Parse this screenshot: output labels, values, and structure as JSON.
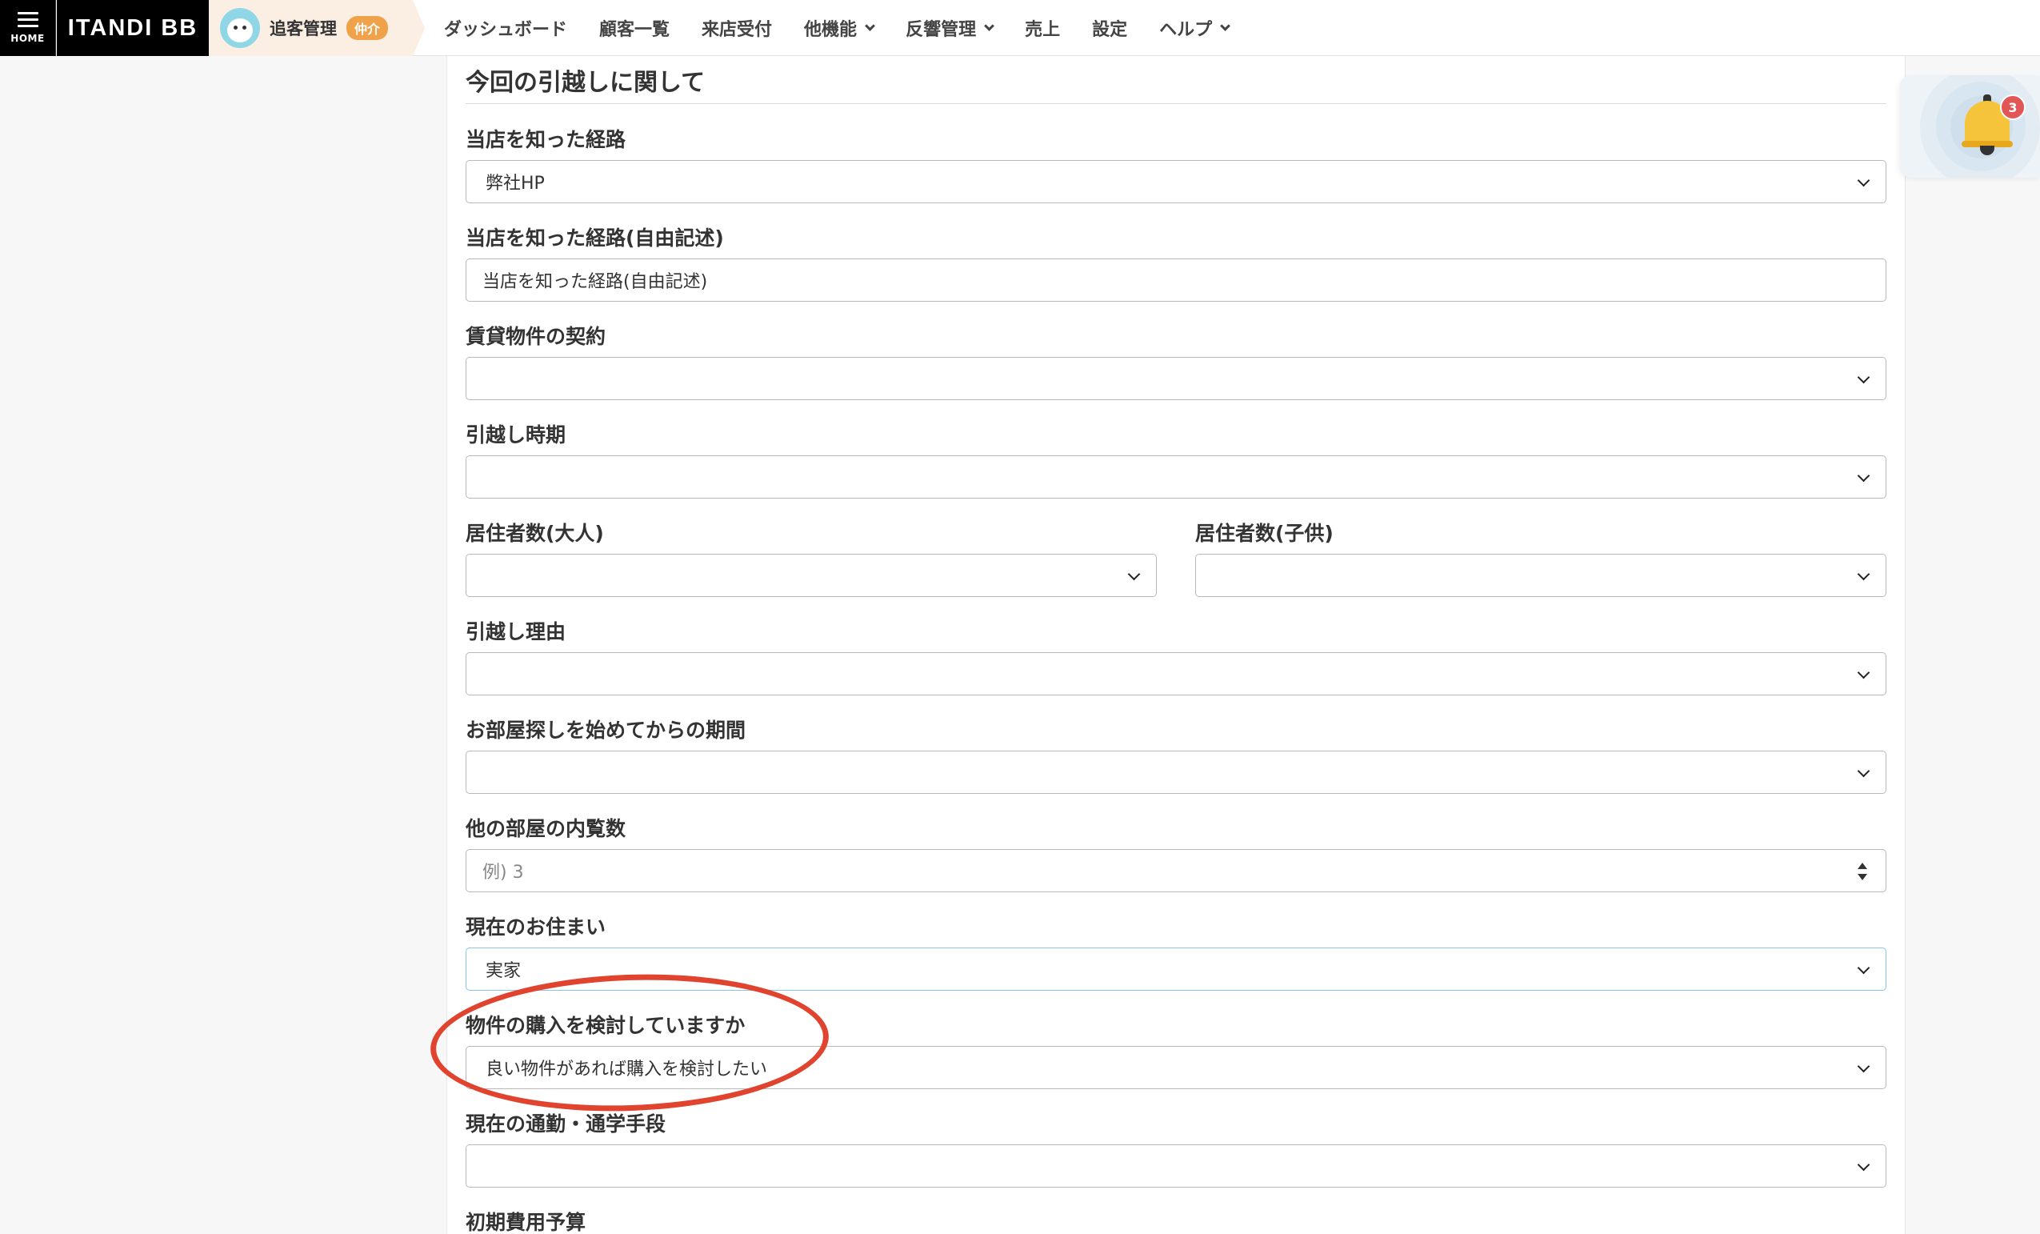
{
  "topbar": {
    "home_label": "HOME",
    "brand": "ITANDI BB",
    "product_name": "追客管理",
    "product_badge": "仲介",
    "nav": [
      {
        "label": "ダッシュボード"
      },
      {
        "label": "顧客一覧"
      },
      {
        "label": "来店受付"
      },
      {
        "label": "他機能"
      },
      {
        "label": "反響管理"
      },
      {
        "label": "売上"
      },
      {
        "label": "設定"
      },
      {
        "label": "ヘルプ"
      }
    ]
  },
  "section": {
    "title": "今回の引越しに関して"
  },
  "fields": {
    "referral": {
      "label": "当店を知った経路",
      "value": "弊社HP"
    },
    "referral_free": {
      "label": "当店を知った経路(自由記述)",
      "placeholder": "当店を知った経路(自由記述)"
    },
    "rental_contract": {
      "label": "賃貸物件の契約",
      "value": ""
    },
    "move_timing": {
      "label": "引越し時期",
      "value": ""
    },
    "residents_adult": {
      "label": "居住者数(大人)",
      "value": ""
    },
    "residents_child": {
      "label": "居住者数(子供)",
      "value": ""
    },
    "move_reason": {
      "label": "引越し理由",
      "value": ""
    },
    "search_period": {
      "label": "お部屋探しを始めてからの期間",
      "value": ""
    },
    "viewed_count": {
      "label": "他の部屋の内覧数",
      "placeholder": "例) 3"
    },
    "current_residence": {
      "label": "現在のお住まい",
      "value": "実家"
    },
    "purchase_consideration": {
      "label": "物件の購入を検討していますか",
      "value": "良い物件があれば購入を検討したい"
    },
    "commute": {
      "label": "現在の通勤・通学手段",
      "value": ""
    },
    "initial_budget": {
      "label": "初期費用予算"
    }
  },
  "notifications": {
    "count": "3"
  },
  "colors": {
    "annotation": "#e0432e",
    "badge": "#f0a24b",
    "bell": "#f6c43a",
    "notification_badge": "#e25656"
  }
}
